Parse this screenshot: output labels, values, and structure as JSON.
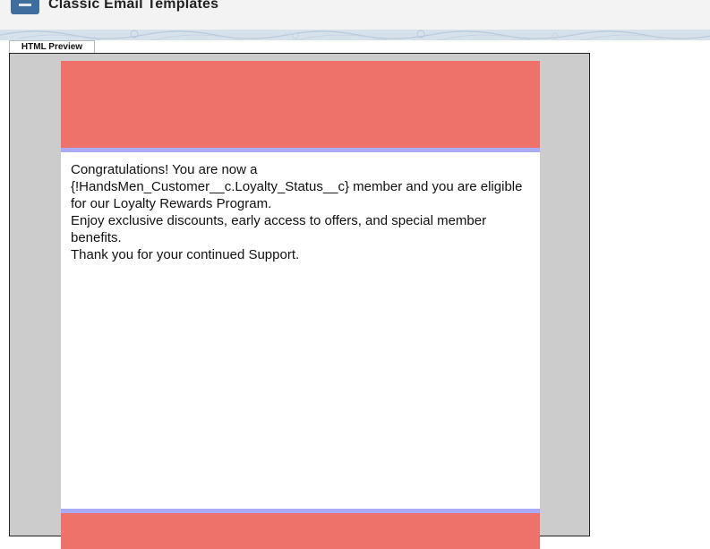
{
  "header": {
    "title": "Classic Email Templates",
    "icon": "email-template-icon",
    "icon_color": "#3f6e9e"
  },
  "tabs": [
    {
      "label": "HTML Preview",
      "active": true
    }
  ],
  "email": {
    "header_color": "#ee716a",
    "accent_color": "#aaaaf5",
    "lines": [
      "Congratulations! You are now a {!HandsMen_Customer__c.Loyalty_Status__c} member and you are eligible for our Loyalty Rewards Program.",
      "Enjoy exclusive discounts, early access to offers, and special member benefits.",
      "Thank you for your continued Support."
    ]
  }
}
